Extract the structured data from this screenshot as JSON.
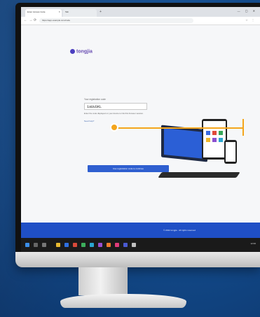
{
  "browser": {
    "tab1_title": "Enter Access Code",
    "tab2_title": "Tab",
    "url": "https://app.example.com/code",
    "new_tab_symbol": "+",
    "window_controls": "— ▢ ✕"
  },
  "page": {
    "logo_text": "tongjia",
    "form_label": "Your registration code",
    "code_value": "1aUuSKL",
    "hint_text": "Enter the code displayed on your device to link this browser session.",
    "link_text": "Need help?",
    "button_label": "Use registration code to continue",
    "footer_text": "© 2022 tongjia · All rights reserved"
  },
  "taskbar": {
    "time": "12:00"
  },
  "colors": {
    "accent": "#2f5fd0",
    "callout": "#f4a51c",
    "background": "#134b8c"
  }
}
